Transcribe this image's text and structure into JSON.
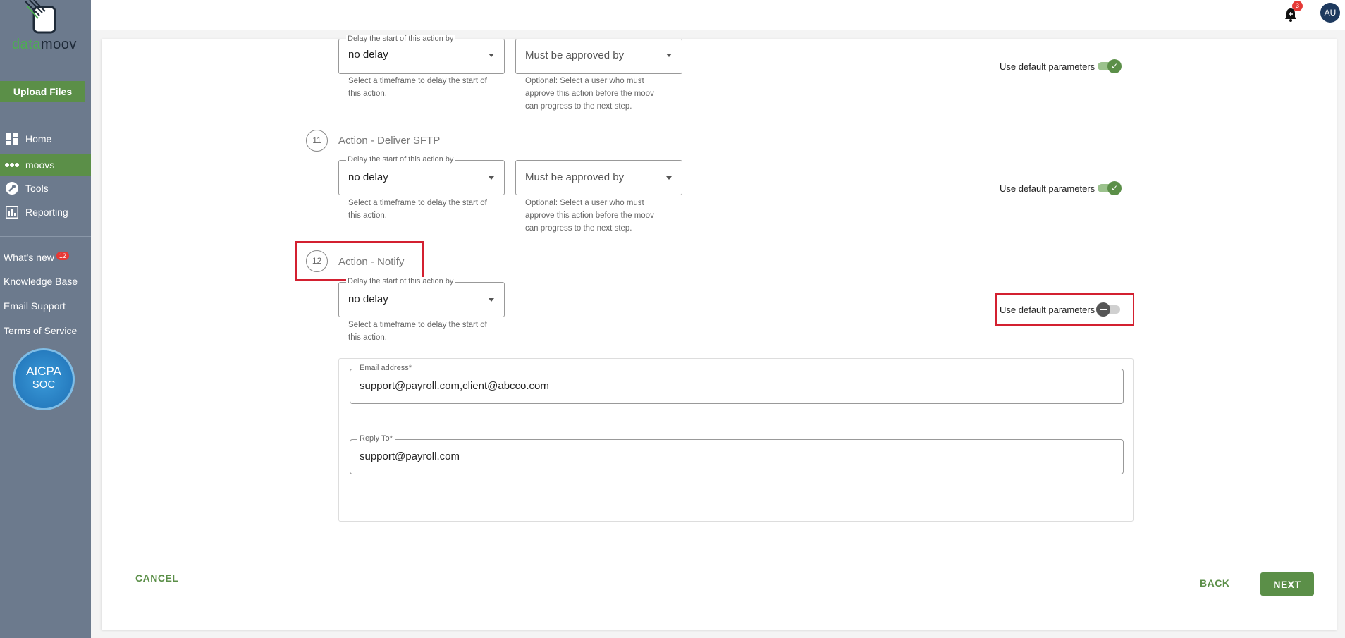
{
  "sidebar": {
    "logo_text_a": "data",
    "logo_text_b": "moov",
    "upload_label": "Upload Files",
    "nav": [
      {
        "label": "Home",
        "icon": "dashboard-icon"
      },
      {
        "label": "moovs",
        "icon": "dots-icon"
      },
      {
        "label": "Tools",
        "icon": "wrench-icon"
      },
      {
        "label": "Reporting",
        "icon": "chart-icon"
      }
    ],
    "links": [
      {
        "label": "What's new",
        "badge": "12"
      },
      {
        "label": "Knowledge Base"
      },
      {
        "label": "Email Support"
      },
      {
        "label": "Terms of Service"
      }
    ],
    "aicpa": {
      "line1": "AICPA",
      "line2": "SOC"
    }
  },
  "topbar": {
    "notification_count": "3",
    "avatar_initials": "AU"
  },
  "steps": [
    {
      "number": "",
      "title": "",
      "delay_label": "Delay the start of this action by",
      "delay_value": "no delay",
      "delay_helper": "Select a timeframe to delay the start of this action.",
      "approval_placeholder": "Must be approved by",
      "approval_helper": "Optional: Select a user who must approve this action before the moov can progress to the next step.",
      "default_params_label": "Use default parameters",
      "default_params_on": true
    },
    {
      "number": "11",
      "title": "Action - Deliver SFTP",
      "delay_label": "Delay the start of this action by",
      "delay_value": "no delay",
      "delay_helper": "Select a timeframe to delay the start of this action.",
      "approval_placeholder": "Must be approved by",
      "approval_helper": "Optional: Select a user who must approve this action before the moov can progress to the next step.",
      "default_params_label": "Use default parameters",
      "default_params_on": true
    },
    {
      "number": "12",
      "title": "Action - Notify",
      "delay_label": "Delay the start of this action by",
      "delay_value": "no delay",
      "delay_helper": "Select a timeframe to delay the start of this action.",
      "default_params_label": "Use default parameters",
      "default_params_on": false
    }
  ],
  "notify": {
    "email_label": "Email address*",
    "email_value": "support@payroll.com,client@abcco.com",
    "reply_label": "Reply To*",
    "reply_value": "support@payroll.com"
  },
  "footer": {
    "cancel_label": "CANCEL",
    "back_label": "BACK",
    "next_label": "NEXT"
  },
  "colors": {
    "accent": "#5b8f48",
    "sidebar": "#6c7a8d",
    "highlight": "#d32030"
  }
}
